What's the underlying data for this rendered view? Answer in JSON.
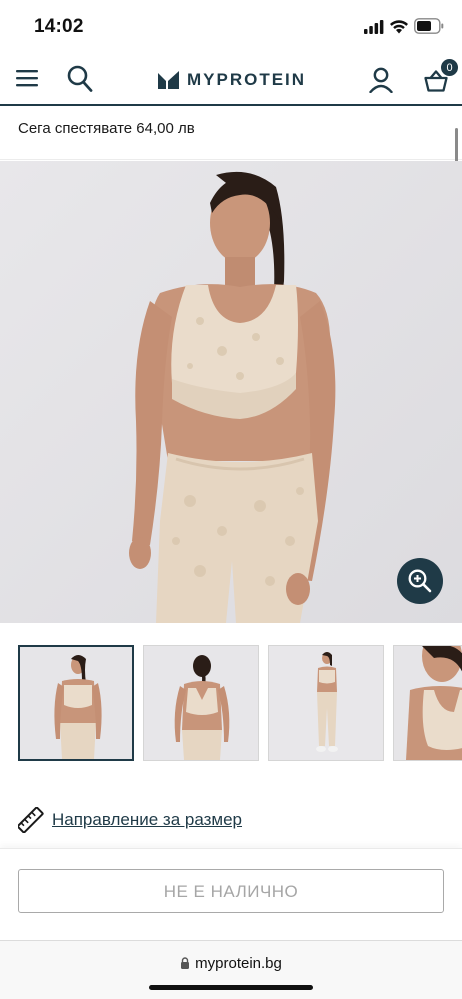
{
  "status_bar": {
    "time": "14:02"
  },
  "header": {
    "brand": "MYPROTEIN",
    "basket_count": "0",
    "brand_color": "#1f3a47"
  },
  "savings": {
    "text": "Сега спестявате 64,00 лв"
  },
  "product": {
    "thumbnails": [
      "front view",
      "back view",
      "full length view",
      "detail view"
    ]
  },
  "size_guide": {
    "label": "Направление за размер"
  },
  "purchase": {
    "button_label": "НЕ Е НАЛИЧНО"
  },
  "browser": {
    "url": "myprotein.bg"
  },
  "icons": [
    "menu-icon",
    "search-icon",
    "logo-mark-icon",
    "account-icon",
    "basket-icon",
    "zoom-icon",
    "ruler-icon",
    "lock-icon",
    "signal-icon",
    "wifi-icon",
    "battery-icon"
  ]
}
